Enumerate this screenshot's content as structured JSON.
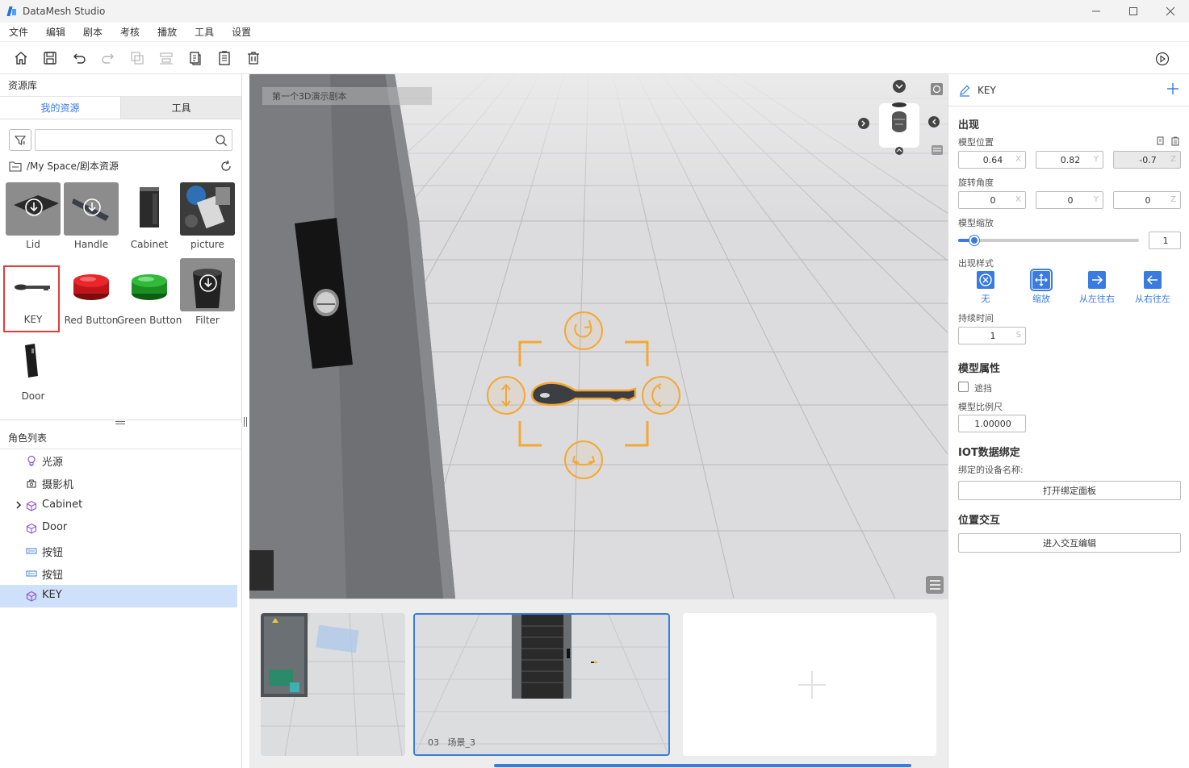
{
  "app": {
    "title": "DataMesh Studio"
  },
  "window": {
    "minimize": "—",
    "maximize": "☐",
    "close": "✕"
  },
  "menu": [
    "文件",
    "编辑",
    "剧本",
    "考核",
    "播放",
    "工具",
    "设置"
  ],
  "toolbar": {
    "tools": [
      "home-icon",
      "save-icon",
      "undo-icon",
      "redo-icon",
      "copy-icon",
      "align-icon",
      "paste-icon",
      "list-icon",
      "delete-icon"
    ],
    "play": "play-icon"
  },
  "library": {
    "title": "资源库",
    "tabs": [
      "我的资源",
      "工具"
    ],
    "search_placeholder": "",
    "path": "/My Space/剧本资源",
    "assets": [
      {
        "label": "Lid",
        "downloadable": true
      },
      {
        "label": "Handle",
        "downloadable": true
      },
      {
        "label": "Cabinet",
        "downloadable": false
      },
      {
        "label": "picture",
        "downloadable": false
      },
      {
        "label": "KEY",
        "downloadable": false,
        "selected": true
      },
      {
        "label": "Red Button",
        "downloadable": false
      },
      {
        "label": "Green Button",
        "downloadable": false
      },
      {
        "label": "Filter",
        "downloadable": true
      },
      {
        "label": "Door",
        "downloadable": false
      }
    ]
  },
  "roles": {
    "title": "角色列表",
    "items": [
      {
        "label": "光源",
        "icon": "bulb-icon"
      },
      {
        "label": "摄影机",
        "icon": "camera-icon"
      },
      {
        "label": "Cabinet",
        "icon": "cube-icon",
        "expandable": true
      },
      {
        "label": "Door",
        "icon": "cube-icon"
      },
      {
        "label": "按钮",
        "icon": "button-icon"
      },
      {
        "label": "按钮",
        "icon": "button-icon"
      },
      {
        "label": "KEY",
        "icon": "cube-icon",
        "selected": true
      }
    ]
  },
  "viewport": {
    "scene_label": "第一个3D演示剧本"
  },
  "scenes": [
    {
      "label": ""
    },
    {
      "label": "03   场景_3",
      "selected": true
    },
    {
      "label": ""
    }
  ],
  "props": {
    "name": "KEY",
    "appear_title": "出现",
    "position_label": "模型位置",
    "position": {
      "x": "0.64",
      "y": "0.82",
      "z": "-0.7"
    },
    "rotation_label": "旋转角度",
    "rotation": {
      "x": "0",
      "y": "0",
      "z": "0"
    },
    "scale_label": "模型缩放",
    "scale_value": "1",
    "scale_fraction": 0.09,
    "style_label": "出现样式",
    "styles": [
      "无",
      "缩放",
      "从左往右",
      "从右往左"
    ],
    "duration_label": "持续时间",
    "duration": "1",
    "duration_unit": "S",
    "axis": {
      "x": "X",
      "y": "Y",
      "z": "Z"
    },
    "model_attr_title": "模型属性",
    "occlude_label": "遮挡",
    "ratio_label": "模型比例尺",
    "ratio": "1.00000",
    "iot_title": "IOT数据绑定",
    "iot_device_label": "绑定的设备名称:",
    "iot_button": "打开绑定面板",
    "pos_interact_title": "位置交互",
    "interact_button": "进入交互编辑"
  }
}
